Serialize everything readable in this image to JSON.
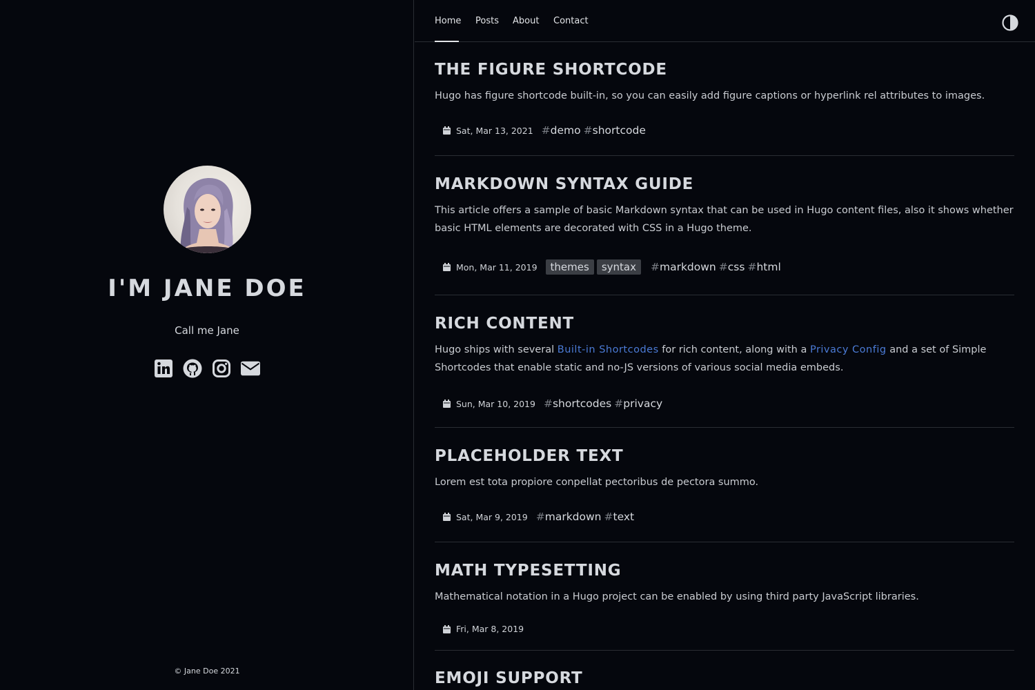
{
  "sidebar": {
    "avatar_alt": "Jane Doe avatar",
    "title": "I'M JANE DOE",
    "subtitle": "Call me Jane",
    "socials": [
      "linkedin-icon",
      "github-icon",
      "instagram-icon",
      "envelope-icon"
    ],
    "copyright": "© Jane Doe 2021"
  },
  "nav": {
    "items": [
      "Home",
      "Posts",
      "About",
      "Contact"
    ],
    "active": "Home",
    "theme_toggle_icon": "contrast-icon"
  },
  "posts": [
    {
      "title": "THE FIGURE SHORTCODE",
      "summary": "Hugo has figure shortcode built-in, so you can easily add figure captions or hyperlink rel attributes to images.",
      "date": "Sat, Mar 13, 2021",
      "categories": [],
      "tags": [
        "demo",
        "shortcode"
      ]
    },
    {
      "title": "MARKDOWN SYNTAX GUIDE",
      "summary": "This article offers a sample of basic Markdown syntax that can be used in Hugo content files, also it shows whether basic HTML elements are decorated with CSS in a Hugo theme.",
      "date": "Mon, Mar 11, 2019",
      "categories": [
        "themes",
        "syntax"
      ],
      "tags": [
        "markdown",
        "css",
        "html"
      ]
    },
    {
      "title": "RICH CONTENT",
      "summary_parts": {
        "p1": "Hugo ships with several ",
        "link1": "Built-in Shortcodes",
        "p2": " for rich content, along with a ",
        "link2": "Privacy Config",
        "p3": " and a set of Simple Shortcodes that enable static and no-JS versions of various social media embeds."
      },
      "date": "Sun, Mar 10, 2019",
      "categories": [],
      "tags": [
        "shortcodes",
        "privacy"
      ]
    },
    {
      "title": "PLACEHOLDER TEXT",
      "summary": "Lorem est tota propiore conpellat pectoribus de pectora summo.",
      "date": "Sat, Mar 9, 2019",
      "categories": [],
      "tags": [
        "markdown",
        "text"
      ]
    },
    {
      "title": "MATH TYPESETTING",
      "summary": "Mathematical notation in a Hugo project can be enabled by using third party JavaScript libraries.",
      "date": "Fri, Mar 8, 2019",
      "categories": [],
      "tags": []
    },
    {
      "title": "EMOJI SUPPORT"
    }
  ],
  "colors": {
    "background": "#05070d",
    "text": "#d6d9de",
    "link": "#4b7bd6",
    "divider": "#2a2d33",
    "category_bg": "#3b3e44"
  }
}
